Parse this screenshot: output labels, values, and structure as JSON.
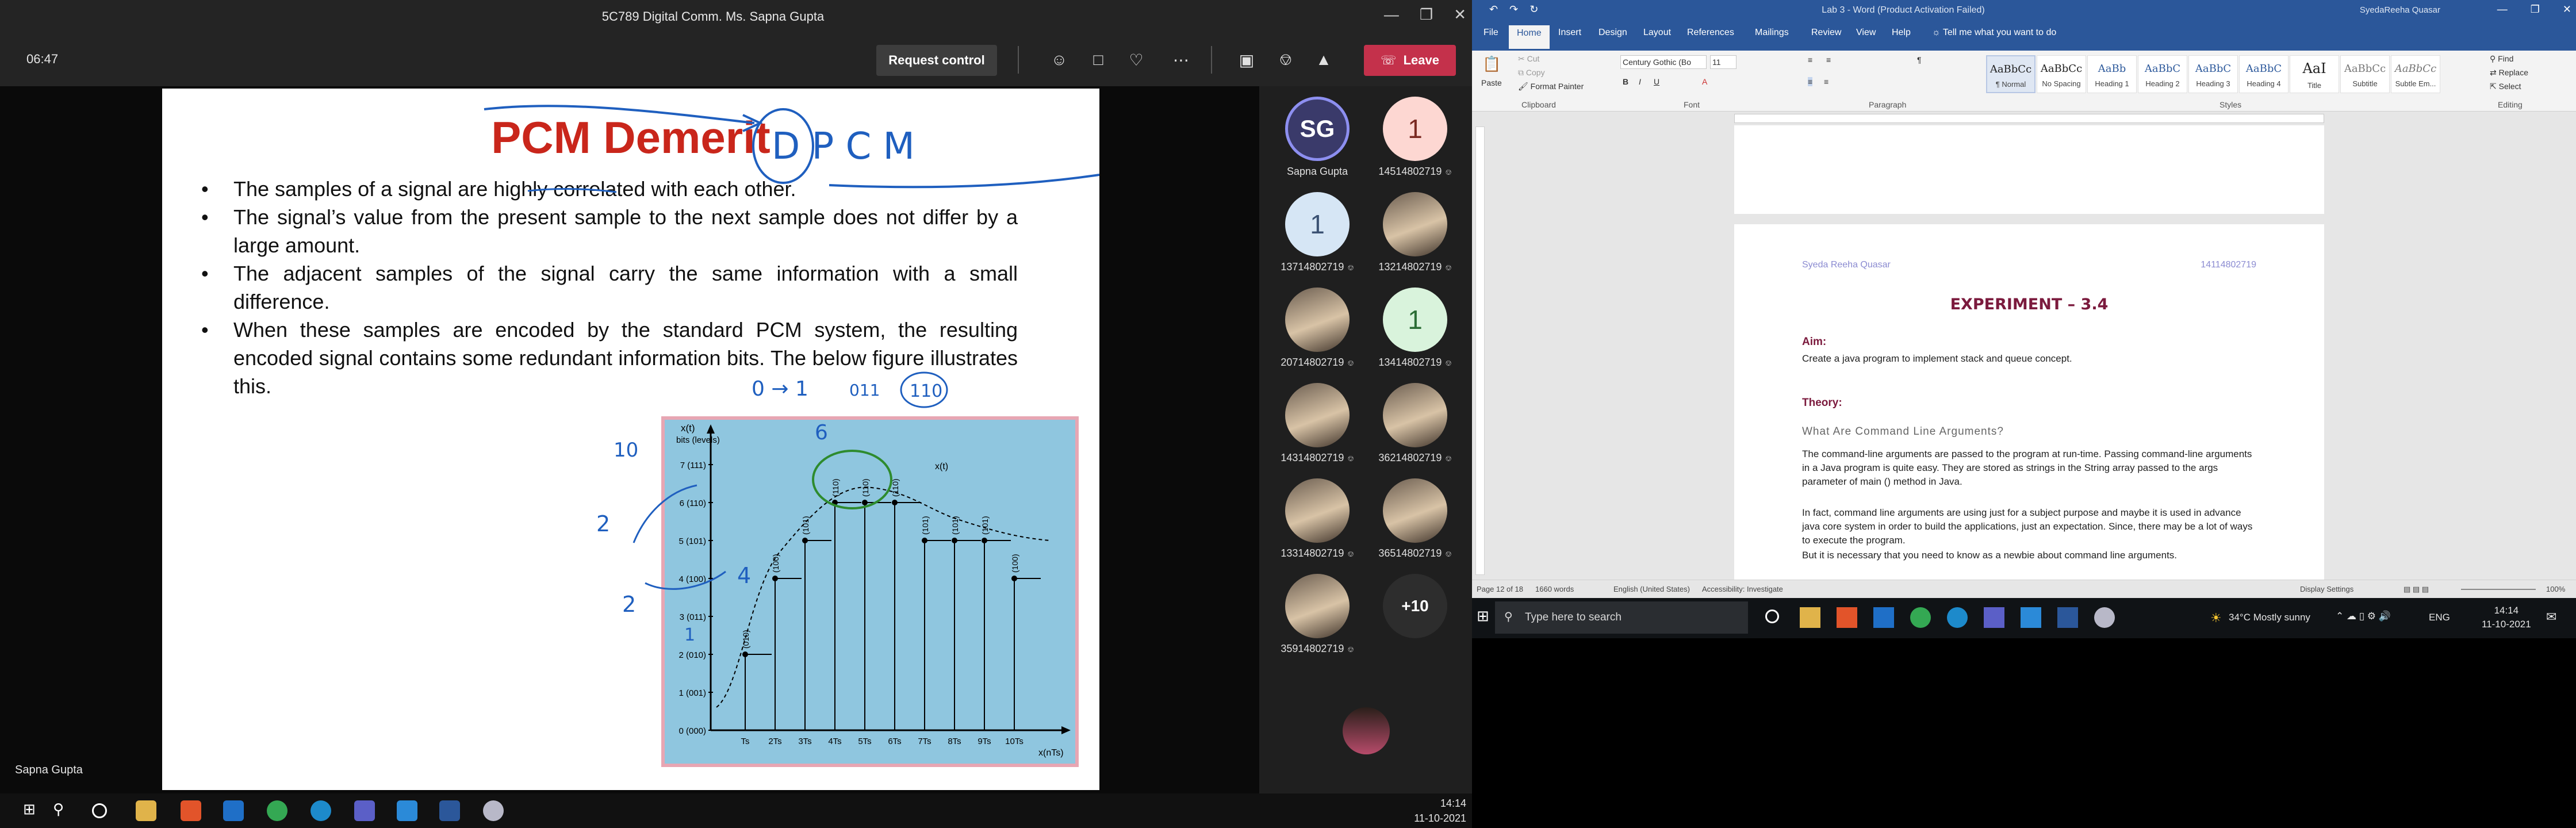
{
  "teams": {
    "title": "5C789 Digital Comm. Ms. Sapna Gupta",
    "timer": "06:47",
    "request_control": "Request control",
    "leave": "Leave",
    "presenter_label": "Sapna Gupta",
    "clock_time": "14:14",
    "clock_date": "11-10-2021"
  },
  "slide": {
    "title": "PCM Demerit",
    "bullets": [
      "The samples of a signal are highly correlated with each other.",
      "The signal’s value from the present sample to the next sample does not differ by a large amount.",
      "The adjacent samples of the signal carry the same information with a small difference.",
      "When these samples are encoded by the standard PCM system, the resulting encoded signal contains some redundant information bits. The below figure illustrates this."
    ],
    "handwriting": [
      "D P C M",
      "0 → 1",
      "011",
      "110",
      "10",
      "6",
      "2",
      "2",
      "4",
      "1"
    ],
    "figure": {
      "y_axis_label": "x(t)",
      "y_axis_sublabel": "bits (levels)",
      "y_ticks": [
        "0 (000)",
        "1 (001)",
        "2 (010)",
        "3 (011)",
        "4 (100)",
        "5 (101)",
        "6 (110)",
        "7 (111)"
      ],
      "x_ticks": [
        "Ts",
        "2Ts",
        "3Ts",
        "4Ts",
        "5Ts",
        "6Ts",
        "7Ts",
        "8Ts",
        "9Ts",
        "10Ts"
      ],
      "x_axis_label": "x(nTs)",
      "curve_label": "x(t)",
      "sample_codes": [
        "(010)",
        "(100)",
        "(101)",
        "(110)",
        "(110)",
        "(110)",
        "(101)",
        "(101)",
        "(101)",
        "(100)"
      ],
      "sample_levels": [
        2,
        4,
        5,
        6,
        6,
        6,
        5,
        5,
        5,
        4
      ]
    }
  },
  "participants": [
    {
      "initials": "SG",
      "name": "Sapna Gupta",
      "style": "ini"
    },
    {
      "initials": "1",
      "name": "14514802719",
      "style": "pink"
    },
    {
      "initials": "1",
      "name": "13714802719",
      "style": "blue"
    },
    {
      "initials": "",
      "name": "13214802719",
      "style": "photo"
    },
    {
      "initials": "",
      "name": "20714802719",
      "style": "photo"
    },
    {
      "initials": "1",
      "name": "13414802719",
      "style": "green"
    },
    {
      "initials": "",
      "name": "14314802719",
      "style": "photo"
    },
    {
      "initials": "",
      "name": "36214802719",
      "style": "photo"
    },
    {
      "initials": "",
      "name": "13314802719",
      "style": "photo"
    },
    {
      "initials": "",
      "name": "36514802719",
      "style": "photo"
    },
    {
      "initials": "",
      "name": "35914802719",
      "style": "photo"
    },
    {
      "initials": "+10",
      "name": "",
      "style": "more"
    }
  ],
  "word": {
    "window_title": "Lab 3  -  Word (Product Activation Failed)",
    "user": "SyedaReeha Quasar",
    "tabs": [
      "File",
      "Home",
      "Insert",
      "Design",
      "Layout",
      "References",
      "Mailings",
      "Review",
      "View",
      "Help",
      "Tell me what you want to do"
    ],
    "font_name": "Century Gothic (Bo",
    "font_size": "11",
    "clipboard": {
      "paste": "Paste",
      "cut": "Cut",
      "copy": "Copy",
      "format_painter": "Format Painter",
      "label": "Clipboard"
    },
    "group_labels": {
      "font": "Font",
      "paragraph": "Paragraph",
      "styles": "Styles",
      "editing": "Editing"
    },
    "styles": [
      {
        "preview": "AaBbCc",
        "name": "¶ Normal"
      },
      {
        "preview": "AaBbCc",
        "name": "No Spacing"
      },
      {
        "preview": "AaBb",
        "name": "Heading 1"
      },
      {
        "preview": "AaBbC",
        "name": "Heading 2"
      },
      {
        "preview": "AaBbC",
        "name": "Heading 3"
      },
      {
        "preview": "AaBbC",
        "name": "Heading 4"
      },
      {
        "preview": "AaI",
        "name": "Title"
      },
      {
        "preview": "AaBbCc",
        "name": "Subtitle"
      },
      {
        "preview": "AaBbCc",
        "name": "Subtle Em..."
      }
    ],
    "editing": {
      "find": "Find",
      "replace": "Replace",
      "select": "Select"
    },
    "doc": {
      "header_name": "Syeda Reeha Quasar",
      "header_num": "14114802719",
      "title": "EXPERIMENT – 3.4",
      "aim_heading": "Aim:",
      "aim_text": "Create a java program to implement stack and queue concept.",
      "theory_heading": "Theory:",
      "sub_heading": "What Are Command Line Arguments?",
      "para1": "The command-line arguments are passed to the program at run-time. Passing command-line arguments in a Java program is quite easy. They are stored as strings in the String array passed to the args parameter of main () method in Java.",
      "para2": "In fact, command line arguments are using just for a subject purpose and maybe it is used in advance java core system in order to build the applications, just an expectation. Since, there may be a lot of ways to execute the program.",
      "para3": "But it is necessary that you need to know as a newbie about command line arguments."
    },
    "status": {
      "page": "Page 12 of 18",
      "words": "1660 words",
      "lang": "English (United States)",
      "accessibility": "Accessibility: Investigate",
      "display": "Display Settings",
      "zoom": "100%"
    }
  },
  "taskbar_right": {
    "search_placeholder": "Type here to search",
    "weather": "34°C  Mostly sunny",
    "lang": "ENG",
    "time": "14:14",
    "date": "11-10-2021"
  }
}
